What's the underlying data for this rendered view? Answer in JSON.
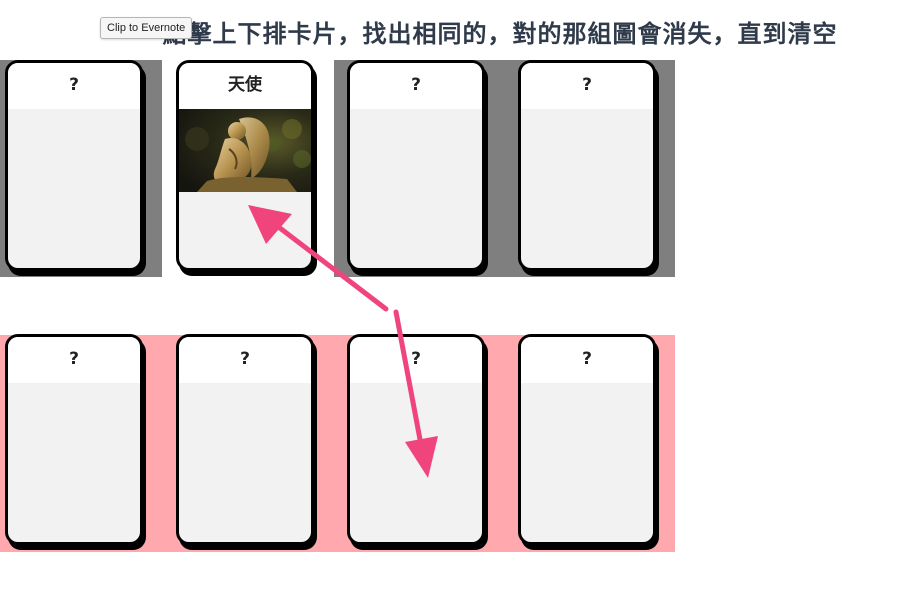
{
  "title": "點擊上下排卡片，找出相同的，對的那組圖會消失，直到清空",
  "tooltip": "Clip to Evernote",
  "colors": {
    "top_row_bg": "#7f7f7f",
    "bottom_row_bg": "#ffa8ae",
    "arrow": "#f0457c"
  },
  "top_row": [
    {
      "label": "?",
      "revealed": false
    },
    {
      "label": "天使",
      "revealed": true,
      "image": "angel-statue-photo"
    },
    {
      "label": "?",
      "revealed": false
    },
    {
      "label": "?",
      "revealed": false
    }
  ],
  "bottom_row": [
    {
      "label": "?",
      "revealed": false
    },
    {
      "label": "?",
      "revealed": false
    },
    {
      "label": "?",
      "revealed": false
    },
    {
      "label": "?",
      "revealed": false
    }
  ]
}
